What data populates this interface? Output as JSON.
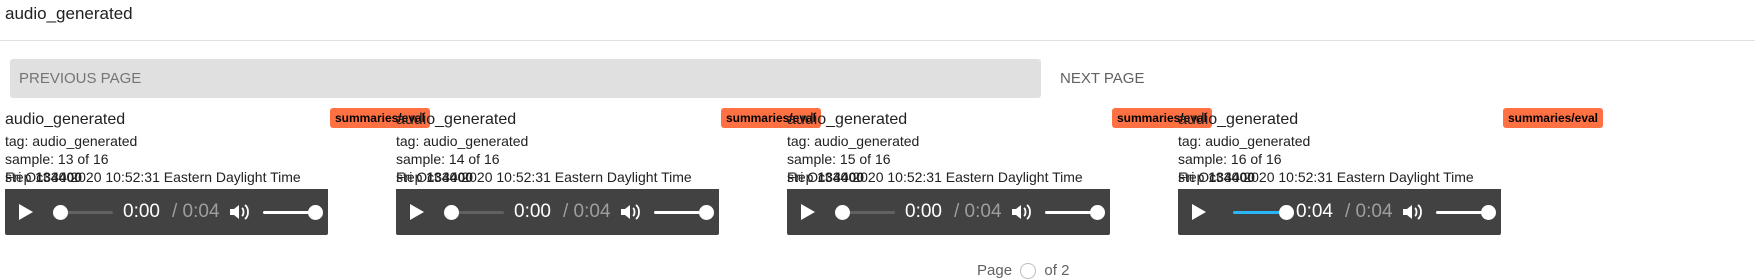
{
  "section_title": "audio_generated",
  "pagination": {
    "previous_label": "PREVIOUS PAGE",
    "next_label": "NEXT PAGE",
    "page_label": "Page",
    "of_label": "of 2"
  },
  "colors": {
    "badge_bg": "#ff7043",
    "player_bg": "#424242",
    "progress_accent": "#29b6f6",
    "disabled_button_bg": "#e0e0e0"
  },
  "cards": [
    {
      "title": "audio_generated",
      "badge": "summaries/eval",
      "tag": "tag: audio_generated",
      "sample": "sample: 13 of 16",
      "step_label": "step",
      "step_value": "134400",
      "timestamp": "Fri Oct 30 2020 10:52:31 Eastern Daylight Time",
      "player": {
        "current": "0:00",
        "duration": "/ 0:04",
        "progress": 0.0,
        "volume": 1.0
      }
    },
    {
      "title": "audio_generated",
      "badge": "summaries/eval",
      "tag": "tag: audio_generated",
      "sample": "sample: 14 of 16",
      "step_label": "step",
      "step_value": "134400",
      "timestamp": "Fri Oct 30 2020 10:52:31 Eastern Daylight Time",
      "player": {
        "current": "0:00",
        "duration": "/ 0:04",
        "progress": 0.0,
        "volume": 1.0
      }
    },
    {
      "title": "audio_generated",
      "badge": "summaries/eval",
      "tag": "tag: audio_generated",
      "sample": "sample: 15 of 16",
      "step_label": "step",
      "step_value": "134400",
      "timestamp": "Fri Oct 30 2020 10:52:31 Eastern Daylight Time",
      "player": {
        "current": "0:00",
        "duration": "/ 0:04",
        "progress": 0.0,
        "volume": 1.0
      }
    },
    {
      "title": "audio_generated",
      "badge": "summaries/eval",
      "tag": "tag: audio_generated",
      "sample": "sample: 16 of 16",
      "step_label": "step",
      "step_value": "134400",
      "timestamp": "Fri Oct 30 2020 10:52:31 Eastern Daylight Time",
      "player": {
        "current": "0:04",
        "duration": "/ 0:04",
        "progress": 1.0,
        "volume": 1.0
      }
    }
  ]
}
